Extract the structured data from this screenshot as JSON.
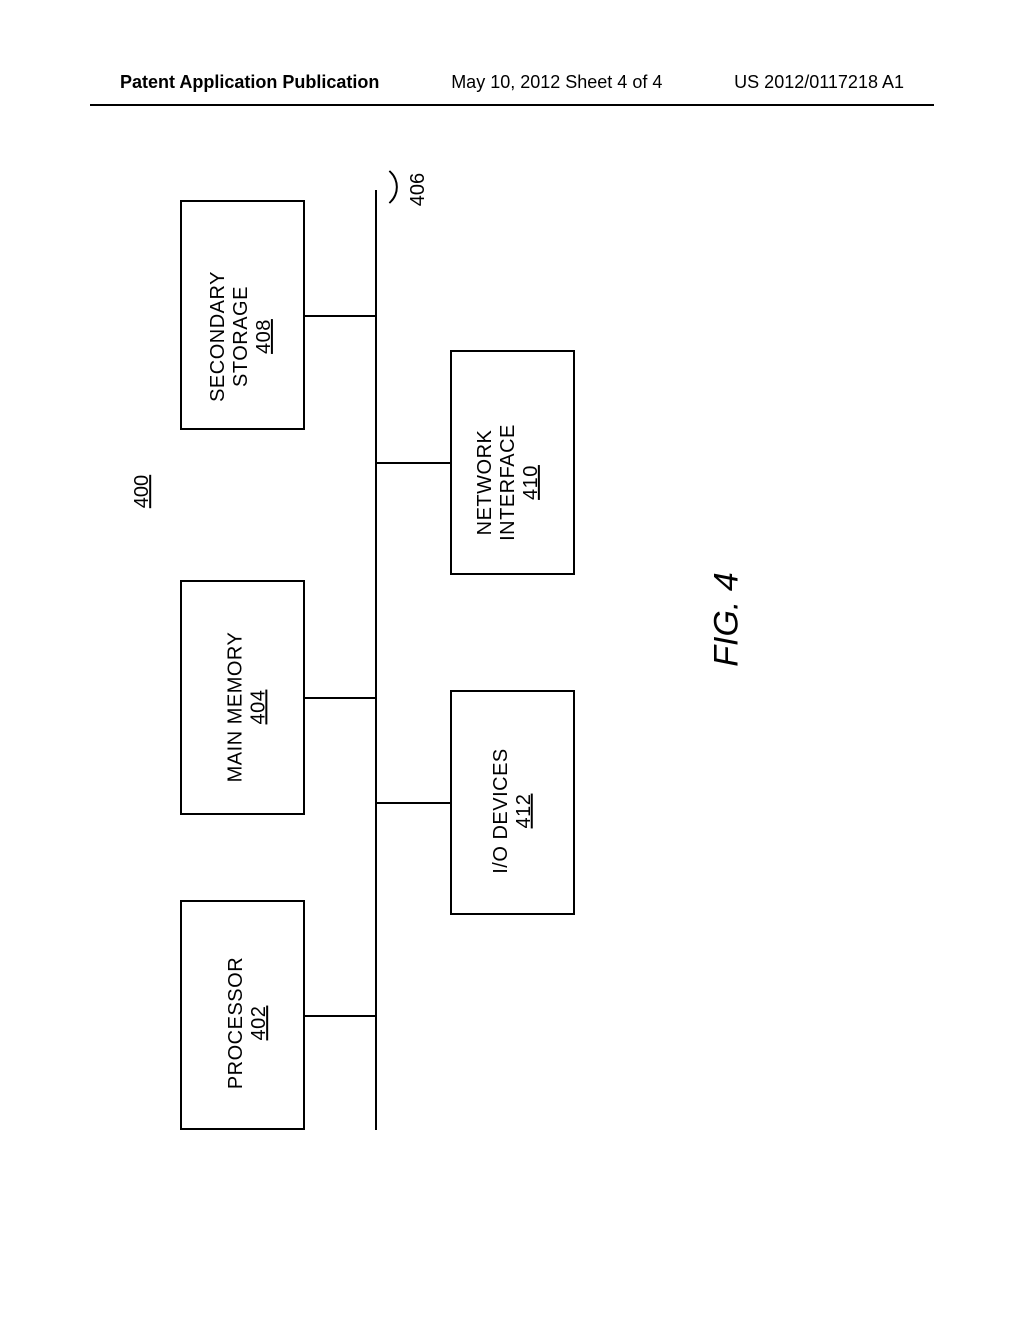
{
  "header": {
    "left": "Patent Application Publication",
    "center": "May 10, 2012  Sheet 4 of 4",
    "right": "US 2012/0117218 A1"
  },
  "figure": {
    "ref_overall": "400",
    "bus_ref": "406",
    "caption": "FIG. 4",
    "blocks": {
      "processor": {
        "title": "PROCESSOR",
        "num": "402"
      },
      "mainmem": {
        "title": "MAIN MEMORY",
        "num": "404"
      },
      "secstore": {
        "title1": "SECONDARY",
        "title2": "STORAGE",
        "num": "408"
      },
      "iodev": {
        "title": "I/O DEVICES",
        "num": "412"
      },
      "netif": {
        "title1": "NETWORK",
        "title2": "INTERFACE",
        "num": "410"
      }
    }
  }
}
